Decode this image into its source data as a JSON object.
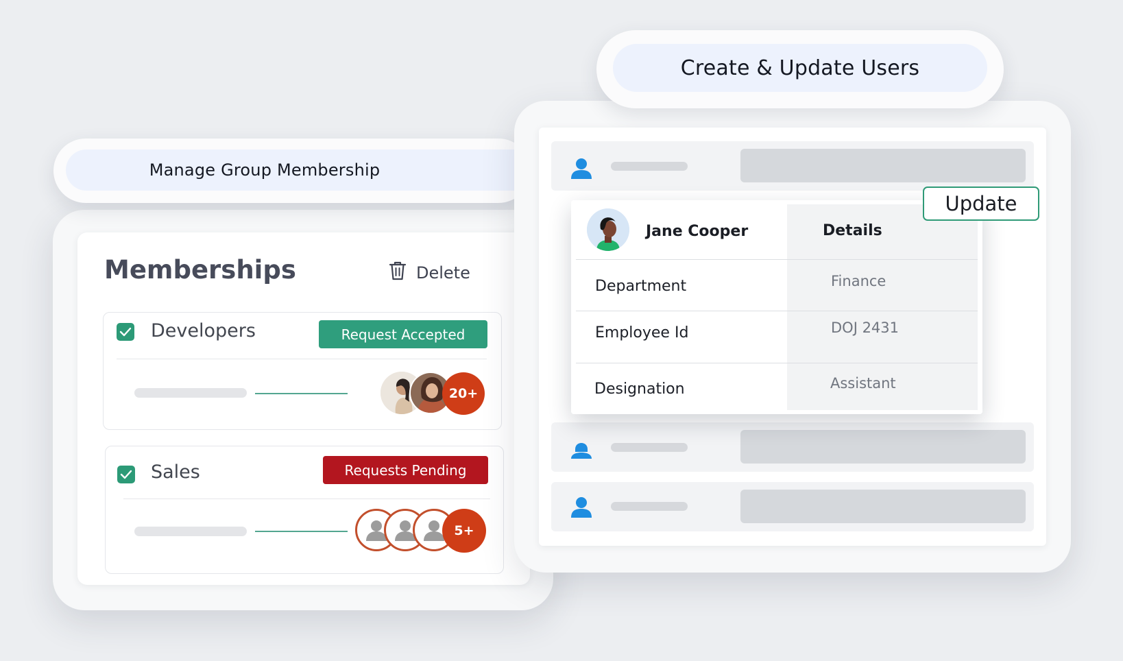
{
  "group_membership": {
    "header_title": "Manage Group Membership",
    "panel_title": "Memberships",
    "delete_label": "Delete",
    "groups": [
      {
        "name": "Developers",
        "checked": true,
        "status": "Request Accepted",
        "status_color": "#2f9e7d",
        "member_count": "20+"
      },
      {
        "name": "Sales",
        "checked": true,
        "status": "Requests Pending",
        "status_color": "#b3161f",
        "member_count": "5+"
      }
    ]
  },
  "user_management": {
    "header_title": "Create & Update Users",
    "update_label": "Update",
    "user": {
      "name": "Jane Cooper",
      "details_header": "Details",
      "fields": [
        {
          "label": "Department",
          "value": "Finance"
        },
        {
          "label": "Employee Id",
          "value": "DOJ 2431"
        },
        {
          "label": "Designation",
          "value": "Assistant"
        }
      ]
    }
  },
  "colors": {
    "accent_green": "#2c9a77",
    "danger_red": "#b3161f",
    "count_orange": "#cf3d17",
    "user_icon_blue": "#1f8de0"
  }
}
